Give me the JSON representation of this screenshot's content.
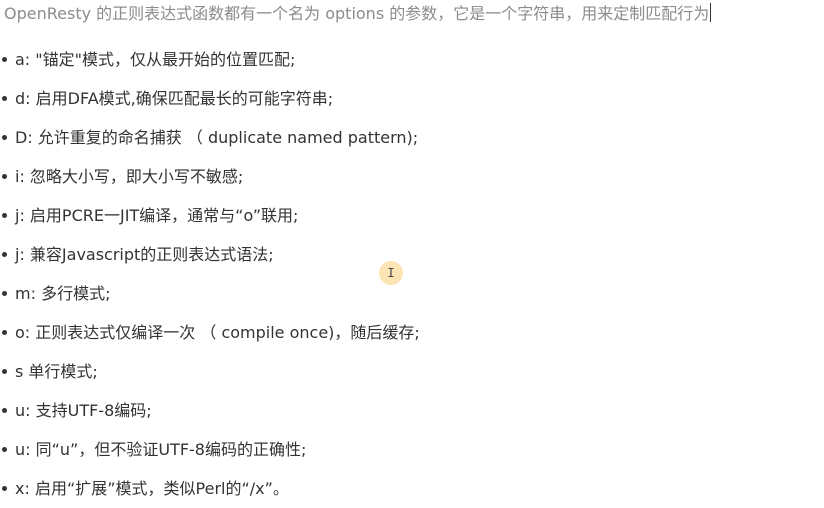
{
  "heading": "OpenResty 的正则表达式函数都有一个名为 options 的参数，它是一个字符串，用来定制匹配行为",
  "options": [
    "a: \"锚定\"模式，仅从最开始的位置匹配;",
    "d:  启用DFA模式,确保匹配最长的可能字符串;",
    "D:  允许重复的命名捕获 （ duplicate named pattern);",
    "i:  忽略大小写，即大小写不敏感;",
    "j:  启用PCRE一JIT编译，通常与“o”联用;",
    "j:  兼容Javascript的正则表达式语法;",
    "m:  多行模式;",
    "o:  正则表达式仅编译一次 （ compile once)，随后缓存;",
    "s  单行模式;",
    "u: 支持UTF-8编码;",
    "u:  同“u”，但不验证UTF-8编码的正确性;",
    "x:  启用“扩展”模式，类似Perl的“/x”。"
  ],
  "cursor": {
    "icon": "text-cursor-icon",
    "glyph": "I"
  }
}
